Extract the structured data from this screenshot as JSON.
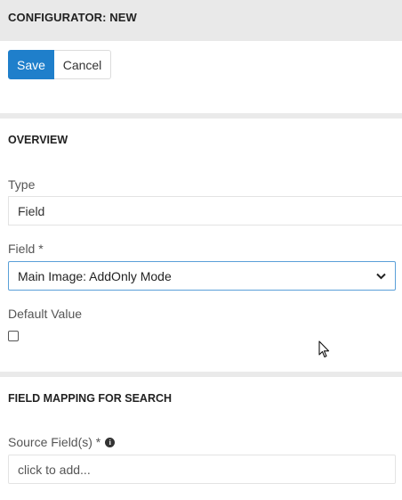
{
  "header": {
    "title": "CONFIGURATOR: NEW"
  },
  "toolbar": {
    "save_label": "Save",
    "cancel_label": "Cancel"
  },
  "overview": {
    "title": "OVERVIEW",
    "type_label": "Type",
    "type_value": "Field",
    "field_label": "Field *",
    "field_selected": "Main Image: AddOnly Mode",
    "default_label": "Default Value",
    "default_checked": false
  },
  "mapping": {
    "title": "FIELD MAPPING FOR SEARCH",
    "source_label": "Source Field(s) *",
    "source_placeholder": "click to add...",
    "info_icon": "info-icon"
  },
  "colors": {
    "primary": "#1f7fcb",
    "header_bg": "#e9e9e9",
    "focus_border": "#5aa0d8"
  }
}
